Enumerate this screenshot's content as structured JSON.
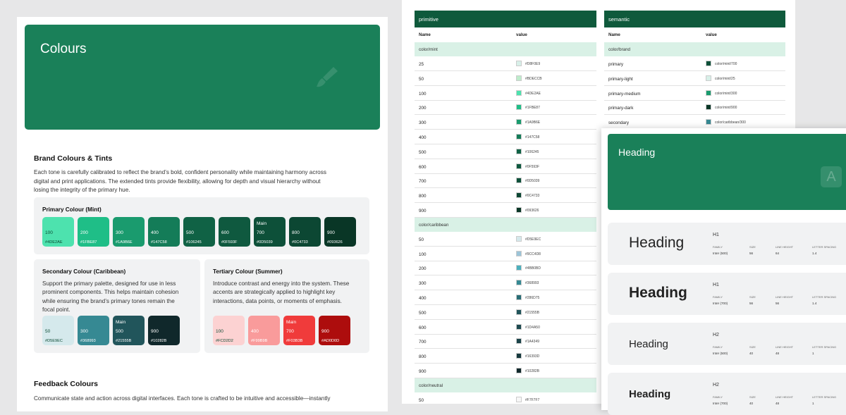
{
  "doc": {
    "hero_title": "Colours",
    "brand_title": "Brand Colours & Tints",
    "brand_para_1": "Each tone is carefully calibrated to reflect the brand’s bold, confident personality while maintaining harmony across",
    "brand_para_2": "digital and print applications. The extended tints provide flexibility, allowing for depth and visual hierarchy without",
    "brand_para_3": "losing the integrity of the primary hue.",
    "primary": {
      "title": "Primary Colour (Mint)",
      "swatches": [
        {
          "num": "100",
          "hex": "#4DE2AE",
          "main": "",
          "color": "#4de2ae",
          "light": true
        },
        {
          "num": "200",
          "hex": "#1FBE87",
          "main": "",
          "color": "#1fbe87",
          "light": false
        },
        {
          "num": "300",
          "hex": "#1A9B6E",
          "main": "",
          "color": "#1a9b6e",
          "light": false
        },
        {
          "num": "400",
          "hex": "#147C58",
          "main": "",
          "color": "#147c58",
          "light": false
        },
        {
          "num": "500",
          "hex": "#106245",
          "main": "",
          "color": "#106245",
          "light": false
        },
        {
          "num": "600",
          "hex": "#0F593F",
          "main": "",
          "color": "#0f593f",
          "light": false
        },
        {
          "num": "700",
          "hex": "#0D5039",
          "main": "Main",
          "color": "#0d5039",
          "light": false
        },
        {
          "num": "800",
          "hex": "#0C4733",
          "main": "",
          "color": "#0c4733",
          "light": false
        },
        {
          "num": "900",
          "hex": "#093626",
          "main": "",
          "color": "#093626",
          "light": false
        }
      ]
    },
    "secondary": {
      "title": "Secondary Colour (Caribbean)",
      "desc_1": "Support the primary palette, designed for use in less",
      "desc_2": "prominent components. This helps maintain cohesion",
      "desc_3": "while ensuring the brand’s primary tones remain the",
      "desc_4": "focal point.",
      "swatches": [
        {
          "num": "50",
          "hex": "#D5E9EC",
          "main": "",
          "color": "#d5e9ec",
          "light": true
        },
        {
          "num": "300",
          "hex": "#368993",
          "main": "",
          "color": "#368993",
          "light": false
        },
        {
          "num": "500",
          "hex": "#21555B",
          "main": "Main",
          "color": "#21555b",
          "light": false
        },
        {
          "num": "900",
          "hex": "#10282B",
          "main": "",
          "color": "#10282b",
          "light": false
        }
      ]
    },
    "tertiary": {
      "title": "Tertiary Colour (Summer)",
      "desc_1": "Introduce contrast and energy into the system. These",
      "desc_2": "accents are strategically applied to highlight key",
      "desc_3": "interactions, data points, or moments of emphasis.",
      "swatches": [
        {
          "num": "100",
          "hex": "#FCD2D2",
          "main": "",
          "color": "#fcd2d2",
          "light": true
        },
        {
          "num": "400",
          "hex": "#F99B9B",
          "main": "",
          "color": "#f99b9b",
          "light": false
        },
        {
          "num": "700",
          "hex": "#F03B3B",
          "main": "Main",
          "color": "#f03b3b",
          "light": false
        },
        {
          "num": "900",
          "hex": "#AD0D0D",
          "main": "",
          "color": "#ad0d0d",
          "light": false
        }
      ]
    },
    "feedback_title": "Feedback Colours",
    "feedback_para": "Communicate state and action across digital interfaces. Each tone is crafted to be intuitive and accessible—instantly"
  },
  "primitive": {
    "header": "primitive",
    "col_name": "Name",
    "col_value": "value",
    "groups": [
      {
        "name": "color/mint",
        "rows": [
          {
            "n": "25",
            "v": "#D8F0E9",
            "c": "#d8f0e9"
          },
          {
            "n": "50",
            "v": "#BDECCB",
            "c": "#bdeccb"
          },
          {
            "n": "100",
            "v": "#4DE2AE",
            "c": "#4de2ae"
          },
          {
            "n": "200",
            "v": "#1FBE87",
            "c": "#1fbe87"
          },
          {
            "n": "300",
            "v": "#1A9B6E",
            "c": "#1a9b6e"
          },
          {
            "n": "400",
            "v": "#147C58",
            "c": "#147c58"
          },
          {
            "n": "500",
            "v": "#106245",
            "c": "#106245"
          },
          {
            "n": "600",
            "v": "#0F593F",
            "c": "#0f593f"
          },
          {
            "n": "700",
            "v": "#0D5039",
            "c": "#0d5039"
          },
          {
            "n": "800",
            "v": "#0C4733",
            "c": "#0c4733"
          },
          {
            "n": "900",
            "v": "#093626",
            "c": "#093626"
          }
        ]
      },
      {
        "name": "color/caribbean",
        "rows": [
          {
            "n": "50",
            "v": "#D5E9EC",
            "c": "#d5e9ec"
          },
          {
            "n": "100",
            "v": "#9CC4D8",
            "c": "#9cc4d8"
          },
          {
            "n": "200",
            "v": "#4BB0BD",
            "c": "#4bb0bd"
          },
          {
            "n": "300",
            "v": "#368993",
            "c": "#368993"
          },
          {
            "n": "400",
            "v": "#286D75",
            "c": "#286d75"
          },
          {
            "n": "500",
            "v": "#21555B",
            "c": "#21555b"
          },
          {
            "n": "600",
            "v": "#1D4A50",
            "c": "#1d4a50"
          },
          {
            "n": "700",
            "v": "#1A4349",
            "c": "#1a4349"
          },
          {
            "n": "800",
            "v": "#16393D",
            "c": "#16393d"
          },
          {
            "n": "900",
            "v": "#10282B",
            "c": "#10282b"
          }
        ]
      },
      {
        "name": "color/neutral",
        "rows": [
          {
            "n": "50",
            "v": "#F7F7F7",
            "c": "#f7f7f7"
          }
        ]
      }
    ]
  },
  "semantic": {
    "header": "semantic",
    "col_name": "Name",
    "col_value": "value",
    "group": "color/brand",
    "rows": [
      {
        "n": "primary",
        "v": "color/mint/700",
        "c": "#0d5039"
      },
      {
        "n": "primary-light",
        "v": "color/mint/25",
        "c": "#d8f0e9"
      },
      {
        "n": "primary-medium",
        "v": "color/mint/300",
        "c": "#1a9b6e"
      },
      {
        "n": "primary-dark",
        "v": "color/mint/900",
        "c": "#093626"
      },
      {
        "n": "secondary",
        "v": "color/caribbean/300",
        "c": "#368993"
      }
    ]
  },
  "heading_panel": {
    "title": "Heading",
    "icon": "letter-a-icon",
    "cards": [
      {
        "sample": "Heading",
        "level": "H1",
        "family": "Inter (500)",
        "size": "56",
        "line_height": "64",
        "spacing": "1.4",
        "weight": "500",
        "font_size": "21"
      },
      {
        "sample": "Heading",
        "level": "H1",
        "family": "Inter (700)",
        "size": "56",
        "line_height": "56",
        "spacing": "1.4",
        "weight": "700",
        "font_size": "21"
      },
      {
        "sample": "Heading",
        "level": "H2",
        "family": "Inter (500)",
        "size": "40",
        "line_height": "48",
        "spacing": "1",
        "weight": "500",
        "font_size": "15"
      },
      {
        "sample": "Heading",
        "level": "H2",
        "family": "Inter (700)",
        "size": "40",
        "line_height": "48",
        "spacing": "1",
        "weight": "700",
        "font_size": "15"
      }
    ],
    "labels": {
      "family": "FAMILY",
      "size": "SIZE",
      "line_height": "LINE HEIGHT",
      "spacing": "LETTER SPACING"
    }
  }
}
